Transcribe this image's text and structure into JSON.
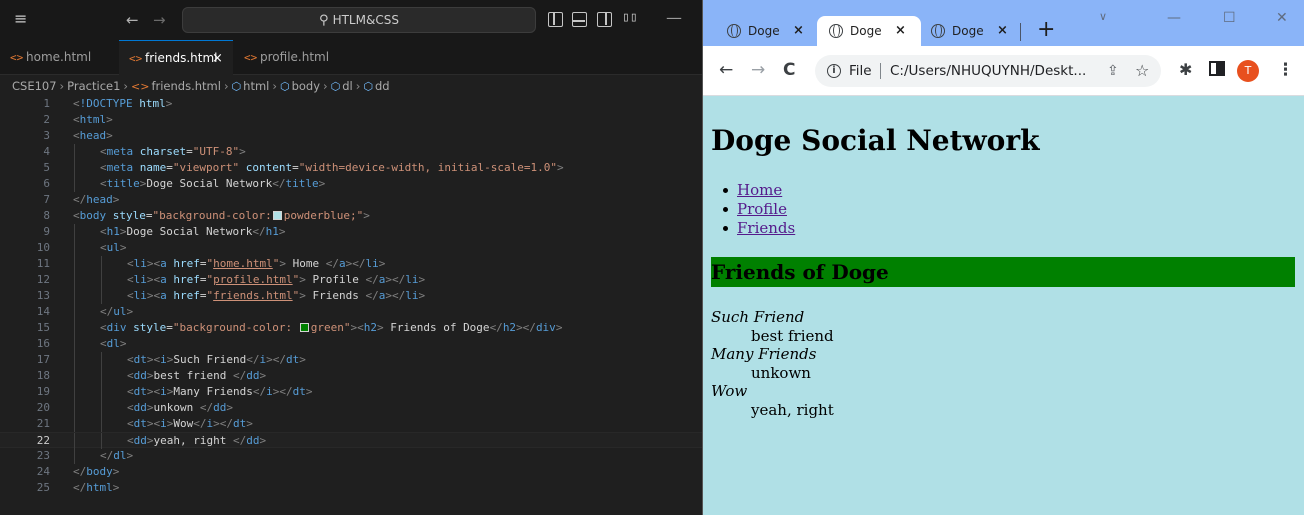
{
  "vscode": {
    "search_label": "HTLM&CSS",
    "tabs": [
      {
        "label": "home.html"
      },
      {
        "label": "friends.html",
        "close": "×"
      },
      {
        "label": "profile.html"
      }
    ],
    "breadcrumb": [
      "CSE107",
      "Practice1",
      "friends.html",
      "html",
      "body",
      "dl",
      "dd"
    ],
    "active_line": 22,
    "line_numbers": [
      "1",
      "2",
      "3",
      "4",
      "5",
      "6",
      "7",
      "8",
      "9",
      "10",
      "11",
      "12",
      "13",
      "14",
      "15",
      "16",
      "17",
      "18",
      "19",
      "20",
      "21",
      "22",
      "23",
      "24",
      "25"
    ],
    "code": {
      "doctype_kw": "!DOCTYPE",
      "doctype_val": "html",
      "html": "html",
      "head": "head",
      "meta": "meta",
      "charset_attr": "charset",
      "charset_val": "\"UTF-8\"",
      "name_attr": "name",
      "name_val": "\"viewport\"",
      "content_attr": "content",
      "content_val": "\"width=device-width, initial-scale=1.0\"",
      "title": "title",
      "title_text": "Doge Social Network",
      "body": "body",
      "style_attr": "style",
      "body_style_open": "\"background-color:",
      "body_style_color": "powderblue;\"",
      "h1": "h1",
      "h1_text": "Doge Social Network",
      "ul": "ul",
      "li": "li",
      "a": "a",
      "href_attr": "href",
      "href1": "home.html",
      "href2": "profile.html",
      "href3": "friends.html",
      "link1_text": " Home ",
      "link2_text": " Profile ",
      "link3_text": " Friends ",
      "div": "div",
      "div_style_open": "\"background-color: ",
      "div_style_color": "green\"",
      "h2": "h2",
      "h2_text": " Friends of Doge",
      "dl": "dl",
      "dt": "dt",
      "dd": "dd",
      "i": "i",
      "dt1": "Such Friend",
      "dd1": "best friend ",
      "dt2": "Many Friends",
      "dd2": "unkown ",
      "dt3": "Wow",
      "dd3": "yeah, right "
    },
    "swatch_colors": {
      "powderblue": "#b0e0e6",
      "green": "#008000"
    }
  },
  "browser": {
    "tabs": [
      {
        "label": "Doge",
        "close": "×"
      },
      {
        "label": "Doge",
        "close": "×"
      },
      {
        "label": "Doge",
        "close": "×"
      }
    ],
    "new_tab": "+",
    "omnibox": {
      "scheme_label": "File",
      "url": "C:/Users/NHUQUYNH/Deskt..."
    },
    "avatar_initial": "T",
    "page": {
      "h1": "Doge Social Network",
      "nav": [
        "Home",
        "Profile",
        "Friends"
      ],
      "h2": "Friends of Doge",
      "dl": [
        {
          "term": "Such Friend",
          "desc": "best friend"
        },
        {
          "term": "Many Friends",
          "desc": "unkown"
        },
        {
          "term": "Wow",
          "desc": "yeah, right"
        }
      ]
    },
    "colors": {
      "page_bg": "#b0e0e6",
      "heading_bar": "#008000",
      "tab_strip": "#8ab4f8",
      "avatar": "#e8501e"
    }
  }
}
